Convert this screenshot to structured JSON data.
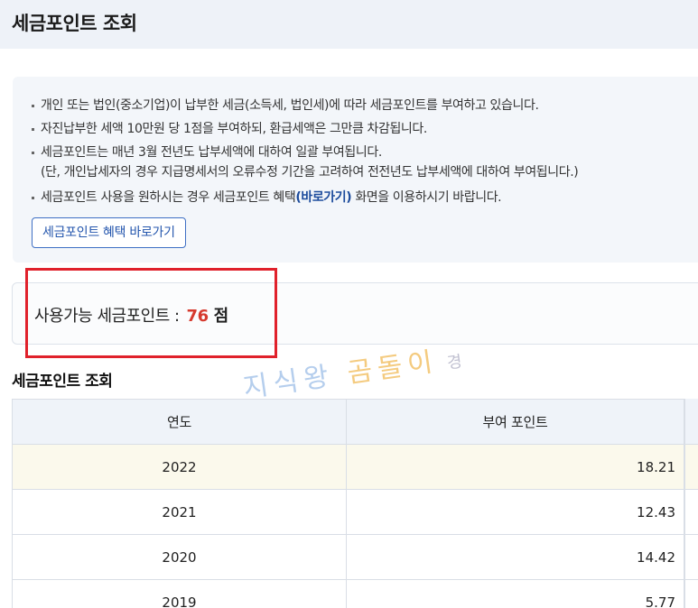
{
  "header": {
    "title": "세금포인트 조회"
  },
  "notice": {
    "items": [
      "개인 또는 법인(중소기업)이 납부한 세금(소득세, 법인세)에 따라 세금포인트를 부여하고 있습니다.",
      "자진납부한 세액 10만원 당 1점을 부여하되, 환급세액은 그만큼 차감됩니다.",
      "세금포인트는 매년 3월 전년도 납부세액에 대하여 일괄 부여됩니다.",
      "(단, 개인납세자의 경우 지급명세서의 오류수정 기간을 고려하여 전전년도 납부세액에 대하여 부여됩니다.)"
    ],
    "benefit_prefix": "세금포인트 사용을 원하시는 경우 세금포인트 혜택",
    "benefit_link": "(바로가기)",
    "benefit_suffix": " 화면을 이용하시기 바랍니다.",
    "button_label": "세금포인트 혜택 바로가기"
  },
  "points": {
    "label": "사용가능 세금포인트 :",
    "value": "76",
    "unit": "점"
  },
  "section": {
    "title": "세금포인트 조회"
  },
  "watermark": {
    "part1": "지식왕",
    "part2": "곰돌이",
    "part3": "경"
  },
  "table": {
    "headers": [
      "연도",
      "부여 포인트"
    ],
    "rows": [
      {
        "year": "2022",
        "points": "18.21"
      },
      {
        "year": "2021",
        "points": "12.43"
      },
      {
        "year": "2020",
        "points": "14.42"
      },
      {
        "year": "2019",
        "points": "5.77"
      }
    ]
  },
  "colors": {
    "accent": "#2456ad",
    "highlight_box": "#e0212b",
    "points_value": "#d63a2e"
  }
}
